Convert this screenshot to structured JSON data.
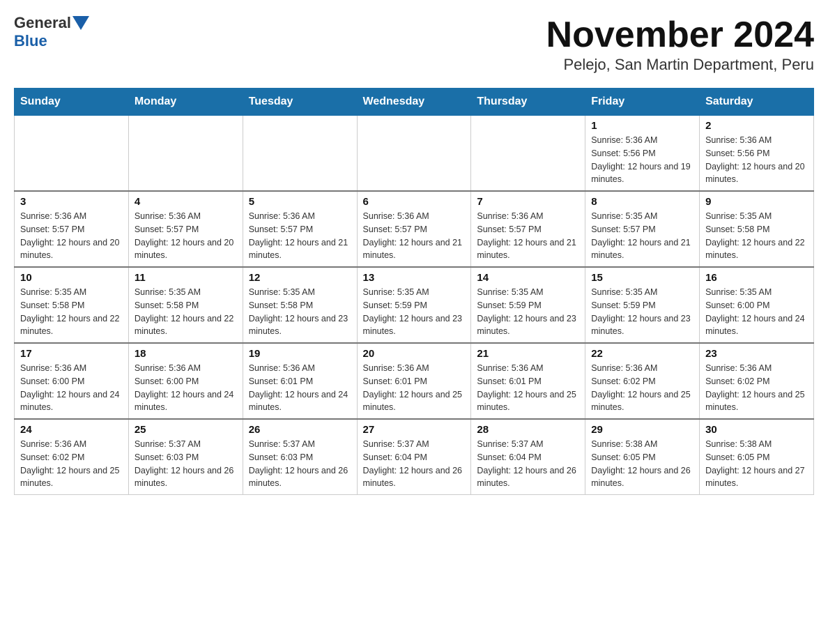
{
  "header": {
    "logo_general": "General",
    "logo_blue": "Blue",
    "title": "November 2024",
    "subtitle": "Pelejo, San Martin Department, Peru"
  },
  "weekdays": [
    "Sunday",
    "Monday",
    "Tuesday",
    "Wednesday",
    "Thursday",
    "Friday",
    "Saturday"
  ],
  "rows": [
    [
      {
        "day": "",
        "sunrise": "",
        "sunset": "",
        "daylight": ""
      },
      {
        "day": "",
        "sunrise": "",
        "sunset": "",
        "daylight": ""
      },
      {
        "day": "",
        "sunrise": "",
        "sunset": "",
        "daylight": ""
      },
      {
        "day": "",
        "sunrise": "",
        "sunset": "",
        "daylight": ""
      },
      {
        "day": "",
        "sunrise": "",
        "sunset": "",
        "daylight": ""
      },
      {
        "day": "1",
        "sunrise": "Sunrise: 5:36 AM",
        "sunset": "Sunset: 5:56 PM",
        "daylight": "Daylight: 12 hours and 19 minutes."
      },
      {
        "day": "2",
        "sunrise": "Sunrise: 5:36 AM",
        "sunset": "Sunset: 5:56 PM",
        "daylight": "Daylight: 12 hours and 20 minutes."
      }
    ],
    [
      {
        "day": "3",
        "sunrise": "Sunrise: 5:36 AM",
        "sunset": "Sunset: 5:57 PM",
        "daylight": "Daylight: 12 hours and 20 minutes."
      },
      {
        "day": "4",
        "sunrise": "Sunrise: 5:36 AM",
        "sunset": "Sunset: 5:57 PM",
        "daylight": "Daylight: 12 hours and 20 minutes."
      },
      {
        "day": "5",
        "sunrise": "Sunrise: 5:36 AM",
        "sunset": "Sunset: 5:57 PM",
        "daylight": "Daylight: 12 hours and 21 minutes."
      },
      {
        "day": "6",
        "sunrise": "Sunrise: 5:36 AM",
        "sunset": "Sunset: 5:57 PM",
        "daylight": "Daylight: 12 hours and 21 minutes."
      },
      {
        "day": "7",
        "sunrise": "Sunrise: 5:36 AM",
        "sunset": "Sunset: 5:57 PM",
        "daylight": "Daylight: 12 hours and 21 minutes."
      },
      {
        "day": "8",
        "sunrise": "Sunrise: 5:35 AM",
        "sunset": "Sunset: 5:57 PM",
        "daylight": "Daylight: 12 hours and 21 minutes."
      },
      {
        "day": "9",
        "sunrise": "Sunrise: 5:35 AM",
        "sunset": "Sunset: 5:58 PM",
        "daylight": "Daylight: 12 hours and 22 minutes."
      }
    ],
    [
      {
        "day": "10",
        "sunrise": "Sunrise: 5:35 AM",
        "sunset": "Sunset: 5:58 PM",
        "daylight": "Daylight: 12 hours and 22 minutes."
      },
      {
        "day": "11",
        "sunrise": "Sunrise: 5:35 AM",
        "sunset": "Sunset: 5:58 PM",
        "daylight": "Daylight: 12 hours and 22 minutes."
      },
      {
        "day": "12",
        "sunrise": "Sunrise: 5:35 AM",
        "sunset": "Sunset: 5:58 PM",
        "daylight": "Daylight: 12 hours and 23 minutes."
      },
      {
        "day": "13",
        "sunrise": "Sunrise: 5:35 AM",
        "sunset": "Sunset: 5:59 PM",
        "daylight": "Daylight: 12 hours and 23 minutes."
      },
      {
        "day": "14",
        "sunrise": "Sunrise: 5:35 AM",
        "sunset": "Sunset: 5:59 PM",
        "daylight": "Daylight: 12 hours and 23 minutes."
      },
      {
        "day": "15",
        "sunrise": "Sunrise: 5:35 AM",
        "sunset": "Sunset: 5:59 PM",
        "daylight": "Daylight: 12 hours and 23 minutes."
      },
      {
        "day": "16",
        "sunrise": "Sunrise: 5:35 AM",
        "sunset": "Sunset: 6:00 PM",
        "daylight": "Daylight: 12 hours and 24 minutes."
      }
    ],
    [
      {
        "day": "17",
        "sunrise": "Sunrise: 5:36 AM",
        "sunset": "Sunset: 6:00 PM",
        "daylight": "Daylight: 12 hours and 24 minutes."
      },
      {
        "day": "18",
        "sunrise": "Sunrise: 5:36 AM",
        "sunset": "Sunset: 6:00 PM",
        "daylight": "Daylight: 12 hours and 24 minutes."
      },
      {
        "day": "19",
        "sunrise": "Sunrise: 5:36 AM",
        "sunset": "Sunset: 6:01 PM",
        "daylight": "Daylight: 12 hours and 24 minutes."
      },
      {
        "day": "20",
        "sunrise": "Sunrise: 5:36 AM",
        "sunset": "Sunset: 6:01 PM",
        "daylight": "Daylight: 12 hours and 25 minutes."
      },
      {
        "day": "21",
        "sunrise": "Sunrise: 5:36 AM",
        "sunset": "Sunset: 6:01 PM",
        "daylight": "Daylight: 12 hours and 25 minutes."
      },
      {
        "day": "22",
        "sunrise": "Sunrise: 5:36 AM",
        "sunset": "Sunset: 6:02 PM",
        "daylight": "Daylight: 12 hours and 25 minutes."
      },
      {
        "day": "23",
        "sunrise": "Sunrise: 5:36 AM",
        "sunset": "Sunset: 6:02 PM",
        "daylight": "Daylight: 12 hours and 25 minutes."
      }
    ],
    [
      {
        "day": "24",
        "sunrise": "Sunrise: 5:36 AM",
        "sunset": "Sunset: 6:02 PM",
        "daylight": "Daylight: 12 hours and 25 minutes."
      },
      {
        "day": "25",
        "sunrise": "Sunrise: 5:37 AM",
        "sunset": "Sunset: 6:03 PM",
        "daylight": "Daylight: 12 hours and 26 minutes."
      },
      {
        "day": "26",
        "sunrise": "Sunrise: 5:37 AM",
        "sunset": "Sunset: 6:03 PM",
        "daylight": "Daylight: 12 hours and 26 minutes."
      },
      {
        "day": "27",
        "sunrise": "Sunrise: 5:37 AM",
        "sunset": "Sunset: 6:04 PM",
        "daylight": "Daylight: 12 hours and 26 minutes."
      },
      {
        "day": "28",
        "sunrise": "Sunrise: 5:37 AM",
        "sunset": "Sunset: 6:04 PM",
        "daylight": "Daylight: 12 hours and 26 minutes."
      },
      {
        "day": "29",
        "sunrise": "Sunrise: 5:38 AM",
        "sunset": "Sunset: 6:05 PM",
        "daylight": "Daylight: 12 hours and 26 minutes."
      },
      {
        "day": "30",
        "sunrise": "Sunrise: 5:38 AM",
        "sunset": "Sunset: 6:05 PM",
        "daylight": "Daylight: 12 hours and 27 minutes."
      }
    ]
  ]
}
